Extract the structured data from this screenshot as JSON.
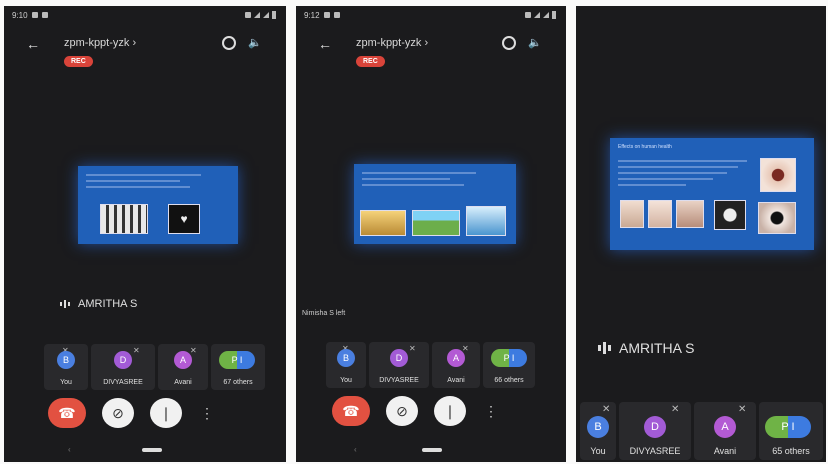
{
  "screens": [
    {
      "status_time": "9:10",
      "meeting_code": "zpm-kppt-yzk",
      "rec_label": "REC",
      "speaker_name": "AMRITHA S",
      "note": "",
      "participants": [
        {
          "initial": "B",
          "name": "You",
          "color": "#4a7fe0"
        },
        {
          "initial": "D",
          "name": "DIVYASREE",
          "color": "#a25bd6"
        },
        {
          "initial": "A",
          "name": "Avani",
          "color": "#b35ad4"
        },
        {
          "initial": "P I",
          "name": "67 others",
          "color": "#6fb346"
        }
      ]
    },
    {
      "status_time": "9:12",
      "meeting_code": "zpm-kppt-yzk",
      "rec_label": "REC",
      "speaker_name": "",
      "note": "Nimisha S left",
      "participants": [
        {
          "initial": "B",
          "name": "You",
          "color": "#4a7fe0"
        },
        {
          "initial": "D",
          "name": "DIVYASREE",
          "color": "#a25bd6"
        },
        {
          "initial": "A",
          "name": "Avani",
          "color": "#b35ad4"
        },
        {
          "initial": "P I",
          "name": "66 others",
          "color": "#6fb346"
        }
      ]
    },
    {
      "status_time": "",
      "meeting_code": "",
      "rec_label": "",
      "speaker_name": "AMRITHA S",
      "note": "",
      "slide_title": "Effects on human health",
      "participants": [
        {
          "initial": "B",
          "name": "You",
          "color": "#4a7fe0"
        },
        {
          "initial": "D",
          "name": "DIVYASREE",
          "color": "#a25bd6"
        },
        {
          "initial": "A",
          "name": "Avani",
          "color": "#b35ad4"
        },
        {
          "initial": "P I",
          "name": "65 others",
          "color": "#6fb346"
        }
      ]
    }
  ],
  "icons": {
    "back": "arrow-left-icon",
    "camera_switch": "camera-switch-icon",
    "speaker": "speaker-icon",
    "hangup": "phone-hangup-icon",
    "video_off": "video-off-icon",
    "mic_off": "mic-off-icon",
    "more": "more-vert-icon"
  },
  "colors": {
    "background": "#1b1b1d",
    "rec": "#d9443a",
    "hangup": "#e25141",
    "slide": "#2060b8"
  }
}
